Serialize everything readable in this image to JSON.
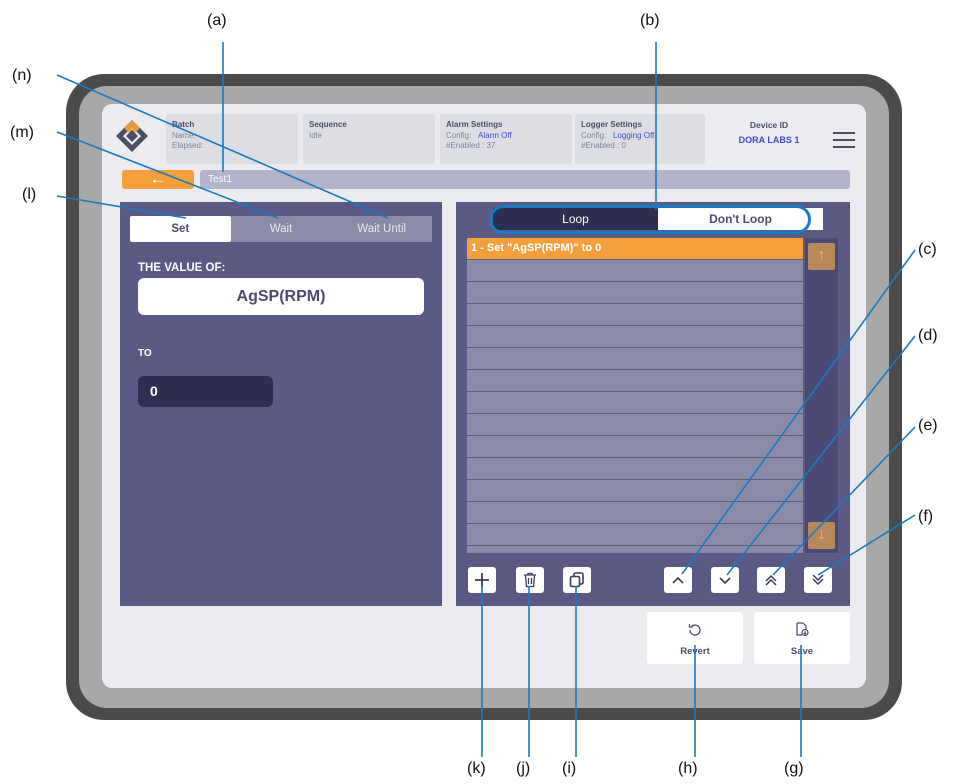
{
  "header": {
    "batch": {
      "title": "Batch",
      "name_label": "Name:",
      "elapsed_label": "Elapsed:"
    },
    "sequence": {
      "title": "Sequence",
      "status": "Idle"
    },
    "alarm": {
      "title": "Alarm Settings",
      "config_label": "Config:",
      "config_value": "Alarm Off",
      "enabled_label": "#Enabled : 37"
    },
    "logger": {
      "title": "Logger Settings",
      "config_label": "Config:",
      "config_value": "Logging Off",
      "enabled_label": "#Enabled : 0"
    },
    "device": {
      "title": "Device ID",
      "value": "DORA LABS 1"
    }
  },
  "sequence_name": "Test1",
  "step_tabs": [
    "Set",
    "Wait",
    "Wait Until"
  ],
  "editor": {
    "value_of_label": "THE VALUE OF:",
    "variable": "AgSP(RPM)",
    "to_label": "TO",
    "to_value": "0"
  },
  "loop_toggle": {
    "loop": "Loop",
    "dont_loop": "Don't Loop",
    "selected": "Don't Loop"
  },
  "steps": [
    "1 - Set \"AgSP(RPM)\" to 0"
  ],
  "actions": {
    "revert": "Revert",
    "save": "Save"
  },
  "annotations": {
    "a": "(a)",
    "b": "(b)",
    "c": "(c)",
    "d": "(d)",
    "e": "(e)",
    "f": "(f)",
    "g": "(g)",
    "h": "(h)",
    "i": "(i)",
    "j": "(j)",
    "k": "(k)",
    "l": "(l)",
    "m": "(m)",
    "n": "(n)"
  },
  "colors": {
    "accent": "#f3a03c",
    "panel": "#5a5a84",
    "highlight_ring": "#1a7abf",
    "link": "#3f4bd0"
  }
}
